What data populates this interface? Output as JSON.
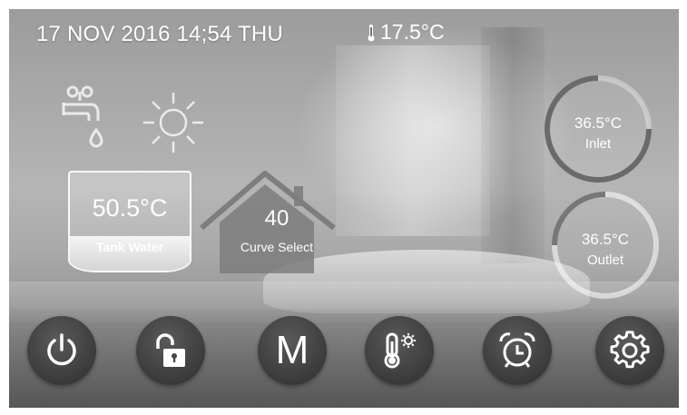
{
  "status_bar": {
    "datetime": "17 NOV 2016 14;54 THU",
    "outdoor_temp": "17.5°C",
    "outdoor_icon": "thermometer-icon"
  },
  "mode_icons": [
    {
      "name": "hot-water-tap-icon"
    },
    {
      "name": "sun-icon"
    }
  ],
  "tank": {
    "temperature": "50.5°C",
    "label": "Tank Water"
  },
  "curve": {
    "value": "40",
    "label": "Curve Select"
  },
  "inlet": {
    "temperature": "36.5°C",
    "label": "Inlet"
  },
  "outlet": {
    "temperature": "36.5°C",
    "label": "Outlet"
  },
  "buttons": [
    {
      "name": "power-button",
      "icon": "power-icon"
    },
    {
      "name": "lock-button",
      "icon": "unlock-icon"
    },
    {
      "name": "mode-button",
      "label": "M"
    },
    {
      "name": "temperature-settings-button",
      "icon": "thermometer-gear-icon"
    },
    {
      "name": "timer-button",
      "icon": "alarm-clock-icon"
    },
    {
      "name": "settings-button",
      "icon": "gear-icon"
    }
  ],
  "colors": {
    "text": "#ffffff",
    "button": "#444444"
  }
}
